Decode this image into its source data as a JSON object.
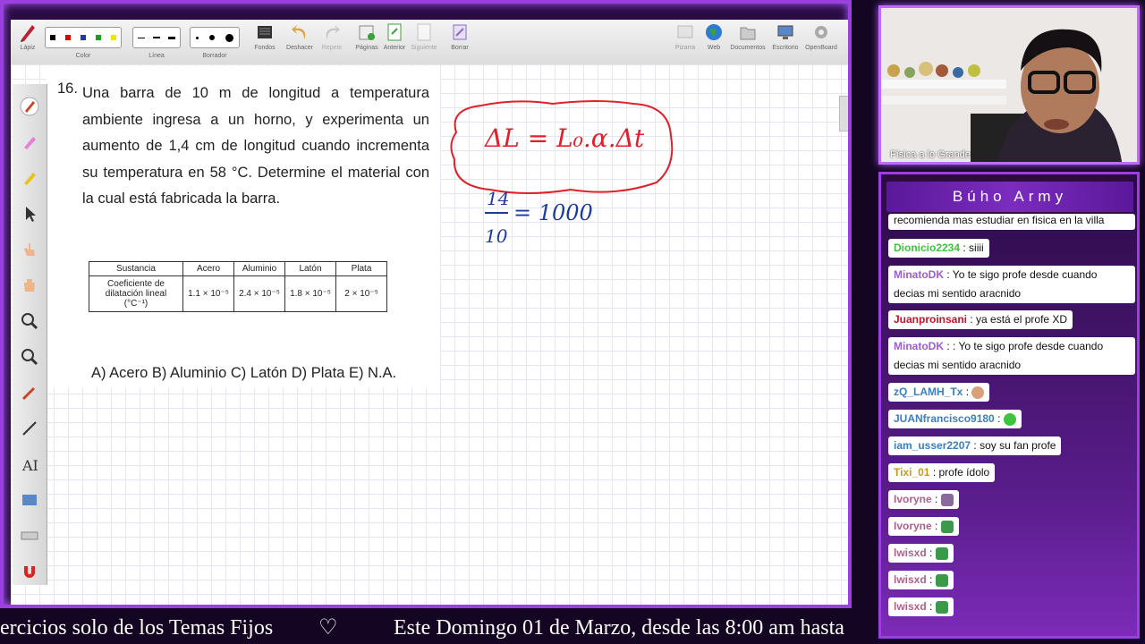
{
  "toolbar": {
    "lapiz": "Lápiz",
    "color": "Color",
    "linea": "Línea",
    "borrador": "Borrador",
    "fondos": "Fondos",
    "deshacer": "Deshacer",
    "repetir": "Repetir",
    "paginas": "Páginas",
    "anterior": "Anterior",
    "siguiente": "Siguiente",
    "borrar": "Borrar",
    "pizarra": "Pizarra",
    "web": "Web",
    "documentos": "Documentos",
    "escritorio": "Escritorio",
    "openboard": "OpenBoard",
    "colors": [
      "#000000",
      "#e00000",
      "#1d3b9c",
      "#1aa01a",
      "#e8e800"
    ]
  },
  "exercise": {
    "number": "16.",
    "text": "Una barra de 10 m de longitud a temperatura ambiente ingresa a un horno, y experimenta un aumento de 1,4 cm de longitud cuando incrementa su temperatura en 58 °C. Determine el material con la cual está fabricada la barra.",
    "table": {
      "header": [
        "Sustancia",
        "Acero",
        "Aluminio",
        "Latón",
        "Plata"
      ],
      "row_label": "Coeficiente de dilatación lineal (°C⁻¹)",
      "values": [
        "1.1 × 10⁻⁵",
        "2.4 × 10⁻⁵",
        "1.8 × 10⁻⁵",
        "2 × 10⁻⁵"
      ]
    },
    "answers": "A) Acero B) Aluminio C) Latón D) Plata E) N.A."
  },
  "handwriting": {
    "formula": "ΔL = L₀.α.Δt",
    "fraction_num": "14",
    "fraction_den": "10",
    "equals": "= 1000"
  },
  "ticker": {
    "text1": "ercicios solo de los Temas Fijos",
    "heart": "♡",
    "text2": "Este Domingo 01 de Marzo, desde las 8:00 am hasta"
  },
  "webcam": {
    "label": "Física a lo Grande"
  },
  "chat": {
    "title": "Búho Army",
    "top_partial": "recomienda mas estudiar en fisica en la villa",
    "messages": [
      {
        "user": "Dionicio2234",
        "color": "#3ec43e",
        "text": ": siiii"
      },
      {
        "user": "MinatoDK",
        "color": "#9b5cd6",
        "text": ": Yo te sigo profe desde cuando decias mi sentido aracnido"
      },
      {
        "user": "Juanproinsani",
        "color": "#c0142b",
        "text": ": ya está el profe XD"
      },
      {
        "user": "MinatoDK",
        "color": "#9b5cd6",
        "text": ": : Yo te sigo profe desde cuando decias mi sentido aracnido"
      },
      {
        "user": "zQ_LAMH_Tx",
        "color": "#3a7fc0",
        "text": ":"
      },
      {
        "user": "JUANfrancisco9180",
        "color": "#3a7fc0",
        "text": ":"
      },
      {
        "user": "iam_usser2207",
        "color": "#3a7fc0",
        "text": ": soy su fan profe"
      },
      {
        "user": "Tixi_01",
        "color": "#c99a1a",
        "text": ": profe ídolo"
      },
      {
        "user": "Ivoryne",
        "color": "#b0608a",
        "text": ":"
      },
      {
        "user": "Ivoryne",
        "color": "#b0608a",
        "text": ":"
      },
      {
        "user": "lwisxd",
        "color": "#b0608a",
        "text": ":"
      },
      {
        "user": "lwisxd",
        "color": "#b0608a",
        "text": ":"
      },
      {
        "user": "lwisxd",
        "color": "#b0608a",
        "text": ":"
      }
    ]
  }
}
